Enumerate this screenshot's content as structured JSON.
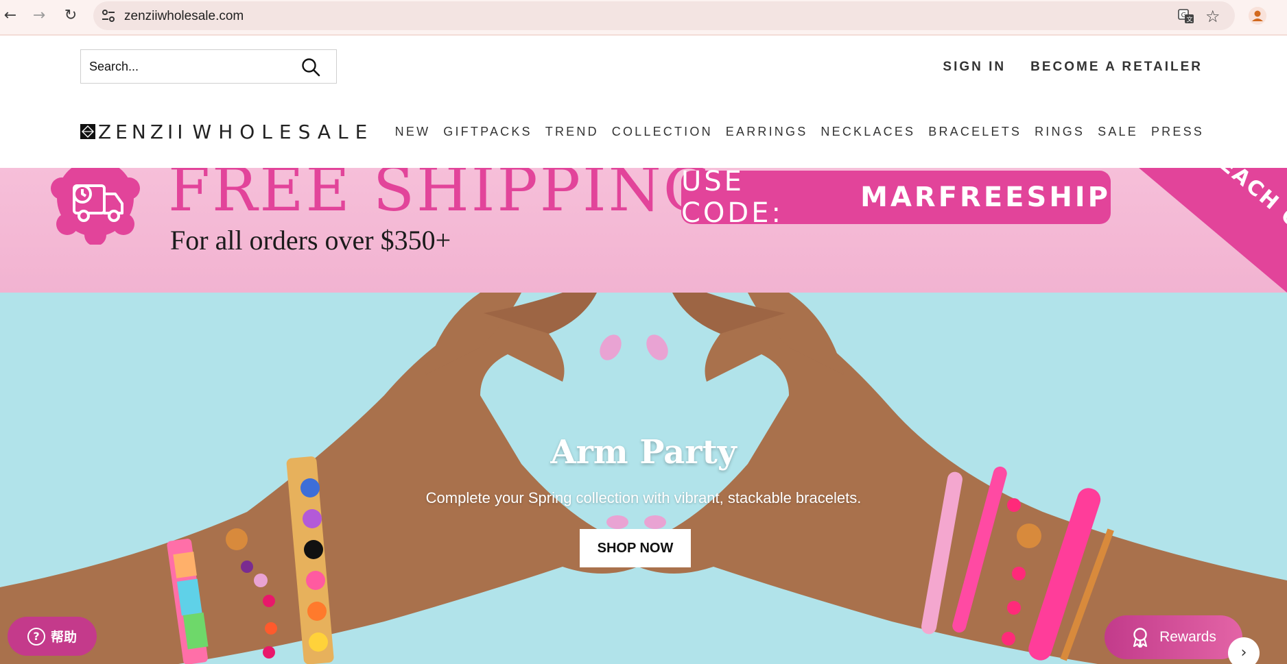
{
  "browser": {
    "back_icon": "←",
    "forward_icon": "→",
    "reload_icon": "↻",
    "url": "zenziiwholesale.com",
    "star_icon": "☆"
  },
  "header": {
    "search_placeholder": "Search...",
    "top_links": [
      "SIGN IN",
      "BECOME A RETAILER"
    ],
    "logo_brand": "ZENZII",
    "logo_suffix": "WHOLESALE",
    "nav": [
      "NEW",
      "GIFTPACKS",
      "TREND",
      "COLLECTION",
      "EARRINGS",
      "NECKLACES",
      "BRACELETS",
      "RINGS",
      "SALE",
      "PRESS"
    ]
  },
  "promo": {
    "headline": "FREE SHIPPING",
    "subline": "For all orders over $350+",
    "code_label": "USE CODE:",
    "code_value": "MARFREESHIP",
    "corner_text": "EACH ONLY",
    "colors": {
      "pink": "#e2449a",
      "background": "#f4b8d5"
    }
  },
  "hero": {
    "title": "Arm Party",
    "subtitle": "Complete your Spring collection with vibrant, stackable bracelets.",
    "cta": "SHOP NOW",
    "background": "#b1e3ea"
  },
  "widgets": {
    "help_icon": "?",
    "help_label": "帮助",
    "rewards_label": "Rewards",
    "next_icon": "›"
  }
}
